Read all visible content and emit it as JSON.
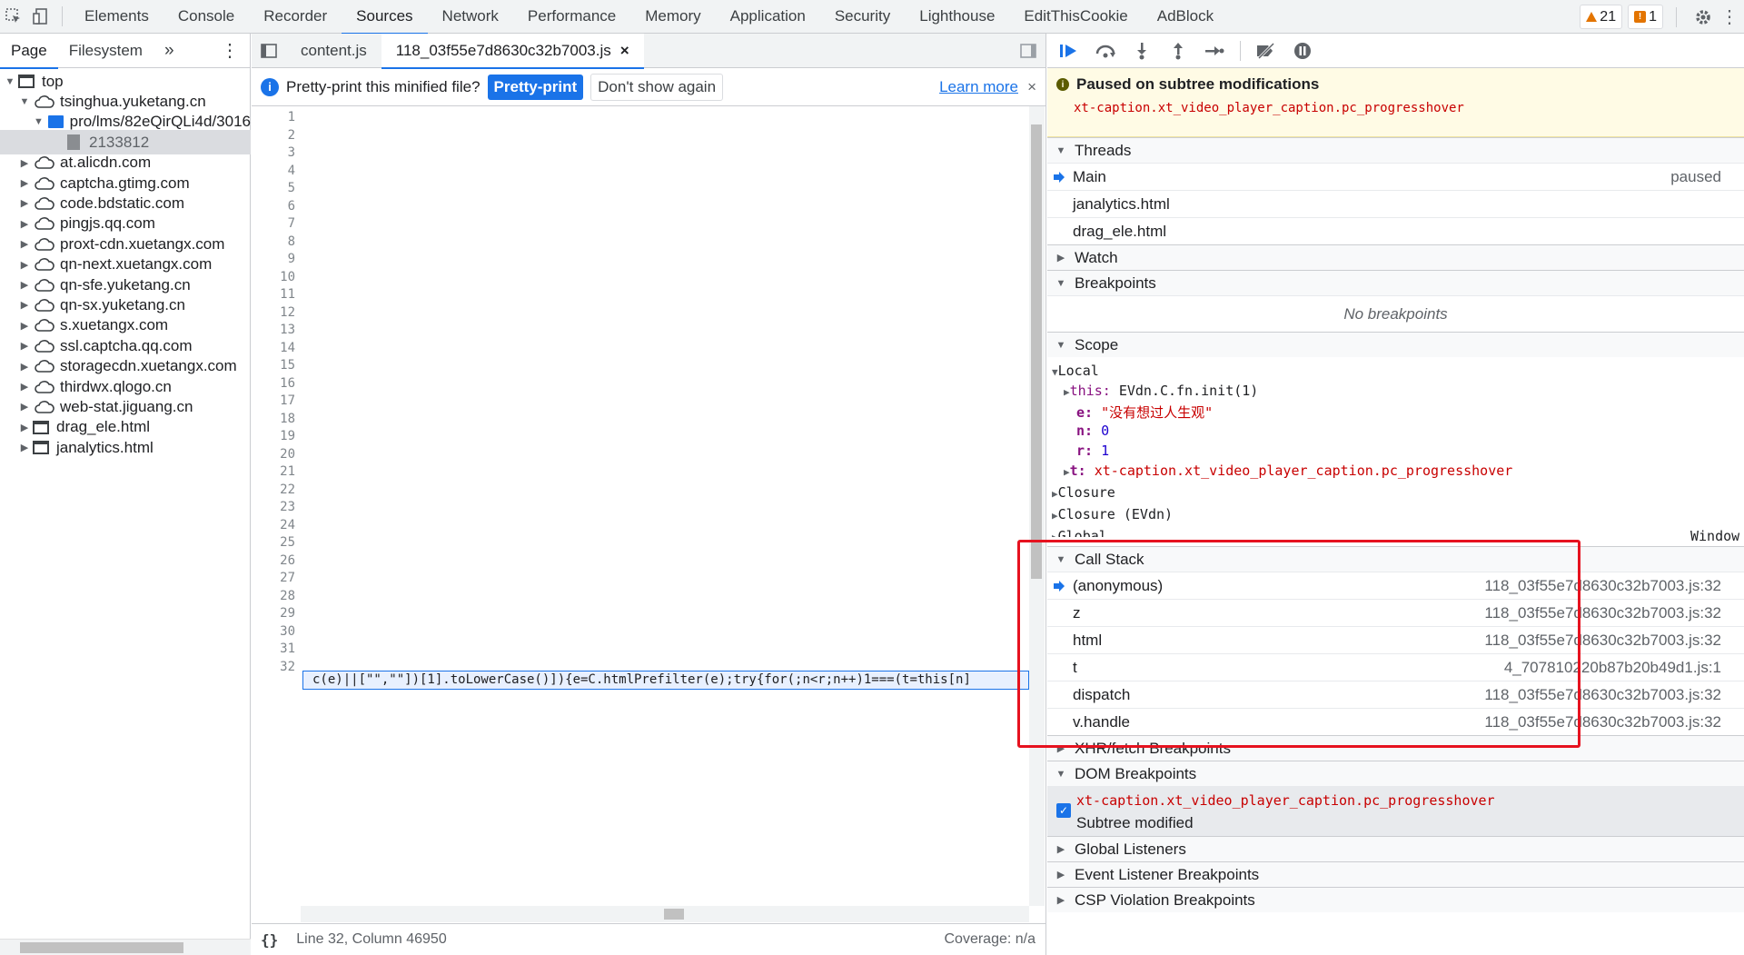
{
  "topbar": {
    "tabs": [
      "Elements",
      "Console",
      "Recorder",
      "Sources",
      "Network",
      "Performance",
      "Memory",
      "Application",
      "Security",
      "Lighthouse",
      "EditThisCookie",
      "AdBlock"
    ],
    "active_tab": "Sources",
    "warnings_count": "21",
    "issues_count": "1"
  },
  "navigator": {
    "tabs": [
      "Page",
      "Filesystem"
    ],
    "more": "»",
    "menu": "⋮",
    "tree": [
      {
        "label": "top",
        "type": "frame",
        "level": 0,
        "expanded": true
      },
      {
        "label": "tsinghua.yuketang.cn",
        "type": "domain",
        "level": 1,
        "expanded": true
      },
      {
        "label": "pro/lms/82eQirQLi4d/3016",
        "type": "folder",
        "level": 2,
        "expanded": true
      },
      {
        "label": "2133812",
        "type": "file",
        "level": 3,
        "selected": true
      },
      {
        "label": "at.alicdn.com",
        "type": "domain",
        "level": 1
      },
      {
        "label": "captcha.gtimg.com",
        "type": "domain",
        "level": 1
      },
      {
        "label": "code.bdstatic.com",
        "type": "domain",
        "level": 1
      },
      {
        "label": "pingjs.qq.com",
        "type": "domain",
        "level": 1
      },
      {
        "label": "proxt-cdn.xuetangx.com",
        "type": "domain",
        "level": 1
      },
      {
        "label": "qn-next.xuetangx.com",
        "type": "domain",
        "level": 1
      },
      {
        "label": "qn-sfe.yuketang.cn",
        "type": "domain",
        "level": 1
      },
      {
        "label": "qn-sx.yuketang.cn",
        "type": "domain",
        "level": 1
      },
      {
        "label": "s.xuetangx.com",
        "type": "domain",
        "level": 1
      },
      {
        "label": "ssl.captcha.qq.com",
        "type": "domain",
        "level": 1
      },
      {
        "label": "storagecdn.xuetangx.com",
        "type": "domain",
        "level": 1
      },
      {
        "label": "thirdwx.qlogo.cn",
        "type": "domain",
        "level": 1
      },
      {
        "label": "web-stat.jiguang.cn",
        "type": "domain",
        "level": 1
      },
      {
        "label": "drag_ele.html",
        "type": "frame",
        "level": 1
      },
      {
        "label": "janalytics.html",
        "type": "frame",
        "level": 1
      }
    ]
  },
  "editor": {
    "tabs": [
      "content.js",
      "118_03f55e7d8630c32b7003.js"
    ],
    "active_tab_index": 1,
    "close_glyph": "×",
    "infobar": {
      "message": "Pretty-print this minified file?",
      "primary": "Pretty-print",
      "secondary": "Don't show again",
      "learn_more": "Learn more",
      "close": "×"
    },
    "line_numbers": [
      "1",
      "2",
      "3",
      "4",
      "5",
      "6",
      "7",
      "8",
      "9",
      "10",
      "11",
      "12",
      "13",
      "14",
      "15",
      "16",
      "17",
      "18",
      "19",
      "20",
      "21",
      "22",
      "23",
      "24",
      "25",
      "26",
      "27",
      "28",
      "29",
      "30",
      "31",
      "32"
    ],
    "code_line_32": "c(e)||[\"\",\"\"])[1].toLowerCase()]){e=C.htmlPrefilter(e);try{for(;n<r;n++)1===(t=this[n]",
    "status": "Line 32, Column 46950",
    "coverage": "Coverage: n/a",
    "format_glyph": "{}"
  },
  "debugger": {
    "paused_title": "Paused on subtree modifications",
    "paused_selector": "xt-caption.xt_video_player_caption.pc_progresshover",
    "threads_label": "Threads",
    "threads": [
      {
        "name": "Main",
        "status": "paused",
        "current": true
      },
      {
        "name": "janalytics.html",
        "status": ""
      },
      {
        "name": "drag_ele.html",
        "status": ""
      }
    ],
    "watch_label": "Watch",
    "breakpoints_label": "Breakpoints",
    "no_breakpoints": "No breakpoints",
    "scope_label": "Scope",
    "scope": {
      "local_label": "Local",
      "this_key": "this:",
      "this_val": "EVdn.C.fn.init(1)",
      "e_key": "e:",
      "e_val": "\"没有想过人生观\"",
      "n_key": "n:",
      "n_val": "0",
      "r_key": "r:",
      "r_val": "1",
      "t_key": "t:",
      "t_val": "xt-caption.xt_video_player_caption.pc_progresshover",
      "closure1": "Closure",
      "closure2": "Closure (EVdn)",
      "global": "Global",
      "global_val": "Window"
    },
    "call_stack_label": "Call Stack",
    "call_stack": [
      {
        "fn": "(anonymous)",
        "loc": "118_03f55e7d8630c32b7003.js:32",
        "current": true
      },
      {
        "fn": "z",
        "loc": "118_03f55e7d8630c32b7003.js:32"
      },
      {
        "fn": "html",
        "loc": "118_03f55e7d8630c32b7003.js:32"
      },
      {
        "fn": "t",
        "loc": "4_707810220b87b20b49d1.js:1"
      },
      {
        "fn": "dispatch",
        "loc": "118_03f55e7d8630c32b7003.js:32"
      },
      {
        "fn": "v.handle",
        "loc": "118_03f55e7d8630c32b7003.js:32"
      }
    ],
    "xhr_label": "XHR/fetch Breakpoints",
    "dom_bp_label": "DOM Breakpoints",
    "dom_bp_selector": "xt-caption.xt_video_player_caption.pc_progresshover",
    "dom_bp_type": "Subtree modified",
    "global_listeners_label": "Global Listeners",
    "event_listener_label": "Event Listener Breakpoints",
    "csp_label": "CSP Violation Breakpoints"
  },
  "colors": {
    "accent": "#1a73e8",
    "highlight_box": "#e6121f",
    "paused_bg": "#fffbe5"
  }
}
